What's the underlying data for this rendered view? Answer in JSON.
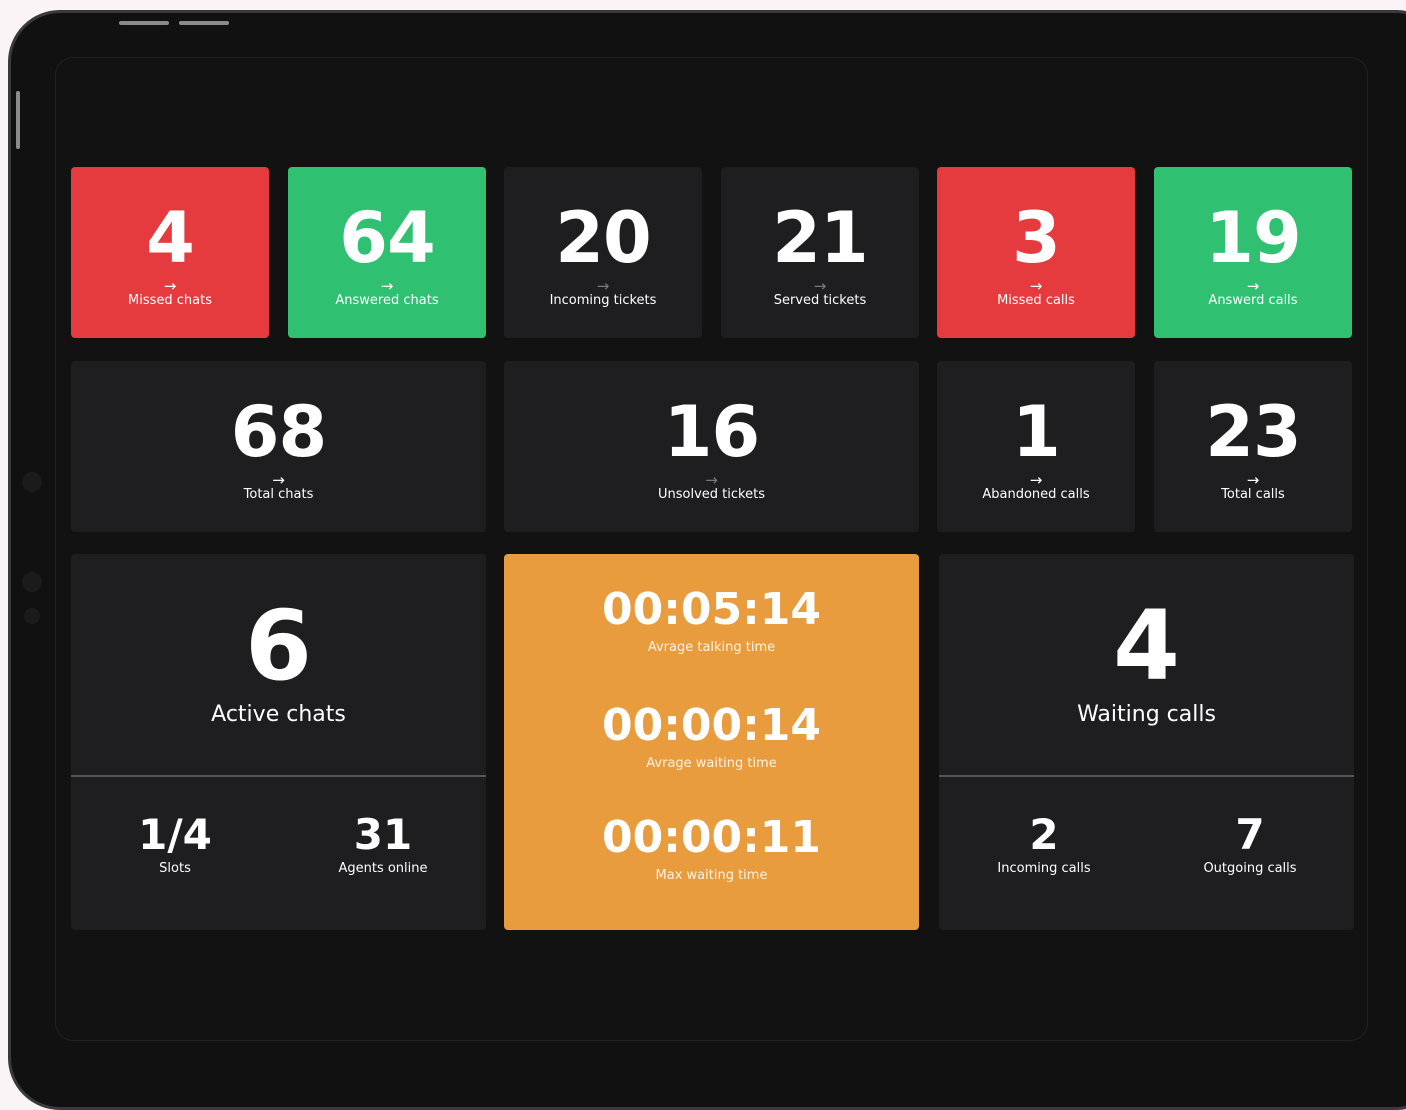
{
  "colors": {
    "red": "#e63b3e",
    "green": "#30c072",
    "orange": "#e99c3e",
    "tile": "#1e1e20",
    "screen": "#121213"
  },
  "icons": {
    "arrow": "right-arrow-icon"
  },
  "row1": [
    {
      "value": "4",
      "label": "Missed chats",
      "status": "red"
    },
    {
      "value": "64",
      "label": "Answered chats",
      "status": "green"
    },
    {
      "value": "20",
      "label": "Incoming tickets",
      "status": "neutral"
    },
    {
      "value": "21",
      "label": "Served tickets",
      "status": "neutral"
    },
    {
      "value": "3",
      "label": "Missed calls",
      "status": "red"
    },
    {
      "value": "19",
      "label": "Answerd calls",
      "status": "green"
    }
  ],
  "row2": [
    {
      "value": "68",
      "label": "Total chats"
    },
    {
      "value": "16",
      "label": "Unsolved tickets"
    },
    {
      "value": "1",
      "label": "Abandoned calls"
    },
    {
      "value": "23",
      "label": "Total calls"
    }
  ],
  "active_chats": {
    "value": "6",
    "label": "Active chats",
    "slots": {
      "value": "1/4",
      "label": "Slots"
    },
    "agents": {
      "value": "31",
      "label": "Agents online"
    }
  },
  "times": [
    {
      "value": "00:05:14",
      "label": "Avrage talking time"
    },
    {
      "value": "00:00:14",
      "label": "Avrage waiting time"
    },
    {
      "value": "00:00:11",
      "label": "Max waiting time"
    }
  ],
  "waiting_calls": {
    "value": "4",
    "label": "Waiting calls",
    "incoming": {
      "value": "2",
      "label": "Incoming calls"
    },
    "outgoing": {
      "value": "7",
      "label": "Outgoing calls"
    }
  }
}
